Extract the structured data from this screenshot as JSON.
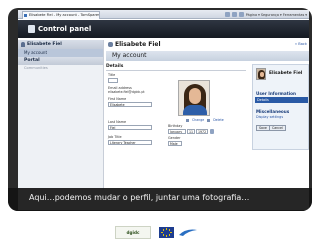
{
  "browser": {
    "tab_title": "Elisabete Fiel - My account - TomSpares",
    "tools": "Página ▾  Segurança ▾  Ferramentas ▾"
  },
  "control_panel": {
    "title": "Control panel"
  },
  "sidebar": {
    "user_header": "Elisabete Fiel",
    "items": [
      {
        "label": "My account"
      }
    ],
    "portal_header": "Portal",
    "portal_items": [
      {
        "label": "Communities"
      }
    ]
  },
  "main": {
    "user_name": "Elisabete Fiel",
    "back_label": "« Back",
    "page_title": "My account",
    "section_title": "Details",
    "fields": {
      "title_label": "Title",
      "email_label": "Email address",
      "email_value": "elisabete.fiel@dgidc.pt",
      "first_name_label": "First Name",
      "first_name_value": "Elisabete",
      "last_name_label": "Last Name",
      "last_name_value": "Fiel",
      "job_title_label": "Job Title",
      "job_title_value": "Literary Teacher",
      "birthday_label": "Birthday",
      "birthday_month": "January",
      "birthday_day": "11",
      "birthday_year": "1972",
      "gender_label": "Gender",
      "gender_value": "Male"
    },
    "photo_links": {
      "change": "Change",
      "delete": "Delete"
    }
  },
  "right_panel": {
    "name": "Elisabete Fiel",
    "user_information": "User Information",
    "details": "Details",
    "miscellaneous": "Miscellaneous",
    "display_settings": "Display settings",
    "save_label": "Save",
    "cancel_label": "Cancel"
  },
  "caption": "Aqui…podemos mudar o perfil, juntar uma fotografia…",
  "footer": {
    "logo_text": "dgidc"
  },
  "colors": {
    "header_dark": "#151a22",
    "accent_blue": "#2a5aa6",
    "panel_bg": "#eef3f9"
  }
}
